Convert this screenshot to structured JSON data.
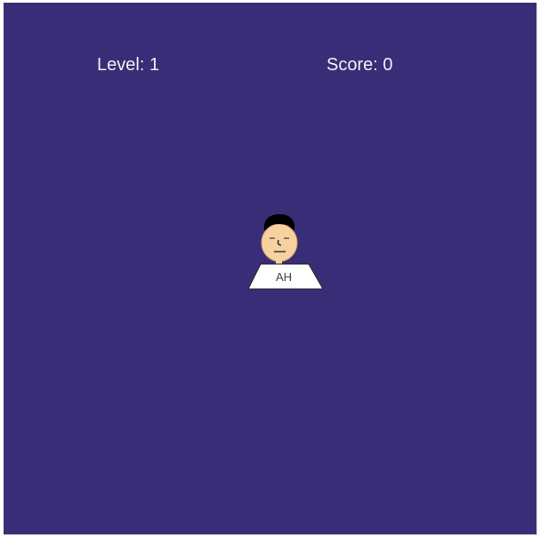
{
  "hud": {
    "level_label": "Level:",
    "level_value": "1",
    "score_label": "Score:",
    "score_value": "0"
  },
  "player": {
    "initials": "AH",
    "icon": "person-head-icon"
  },
  "colors": {
    "background": "#3a2d77",
    "text": "#f2f2f2",
    "skin": "#f7d2a0",
    "hair": "#000000",
    "desk": "#ffffff"
  }
}
